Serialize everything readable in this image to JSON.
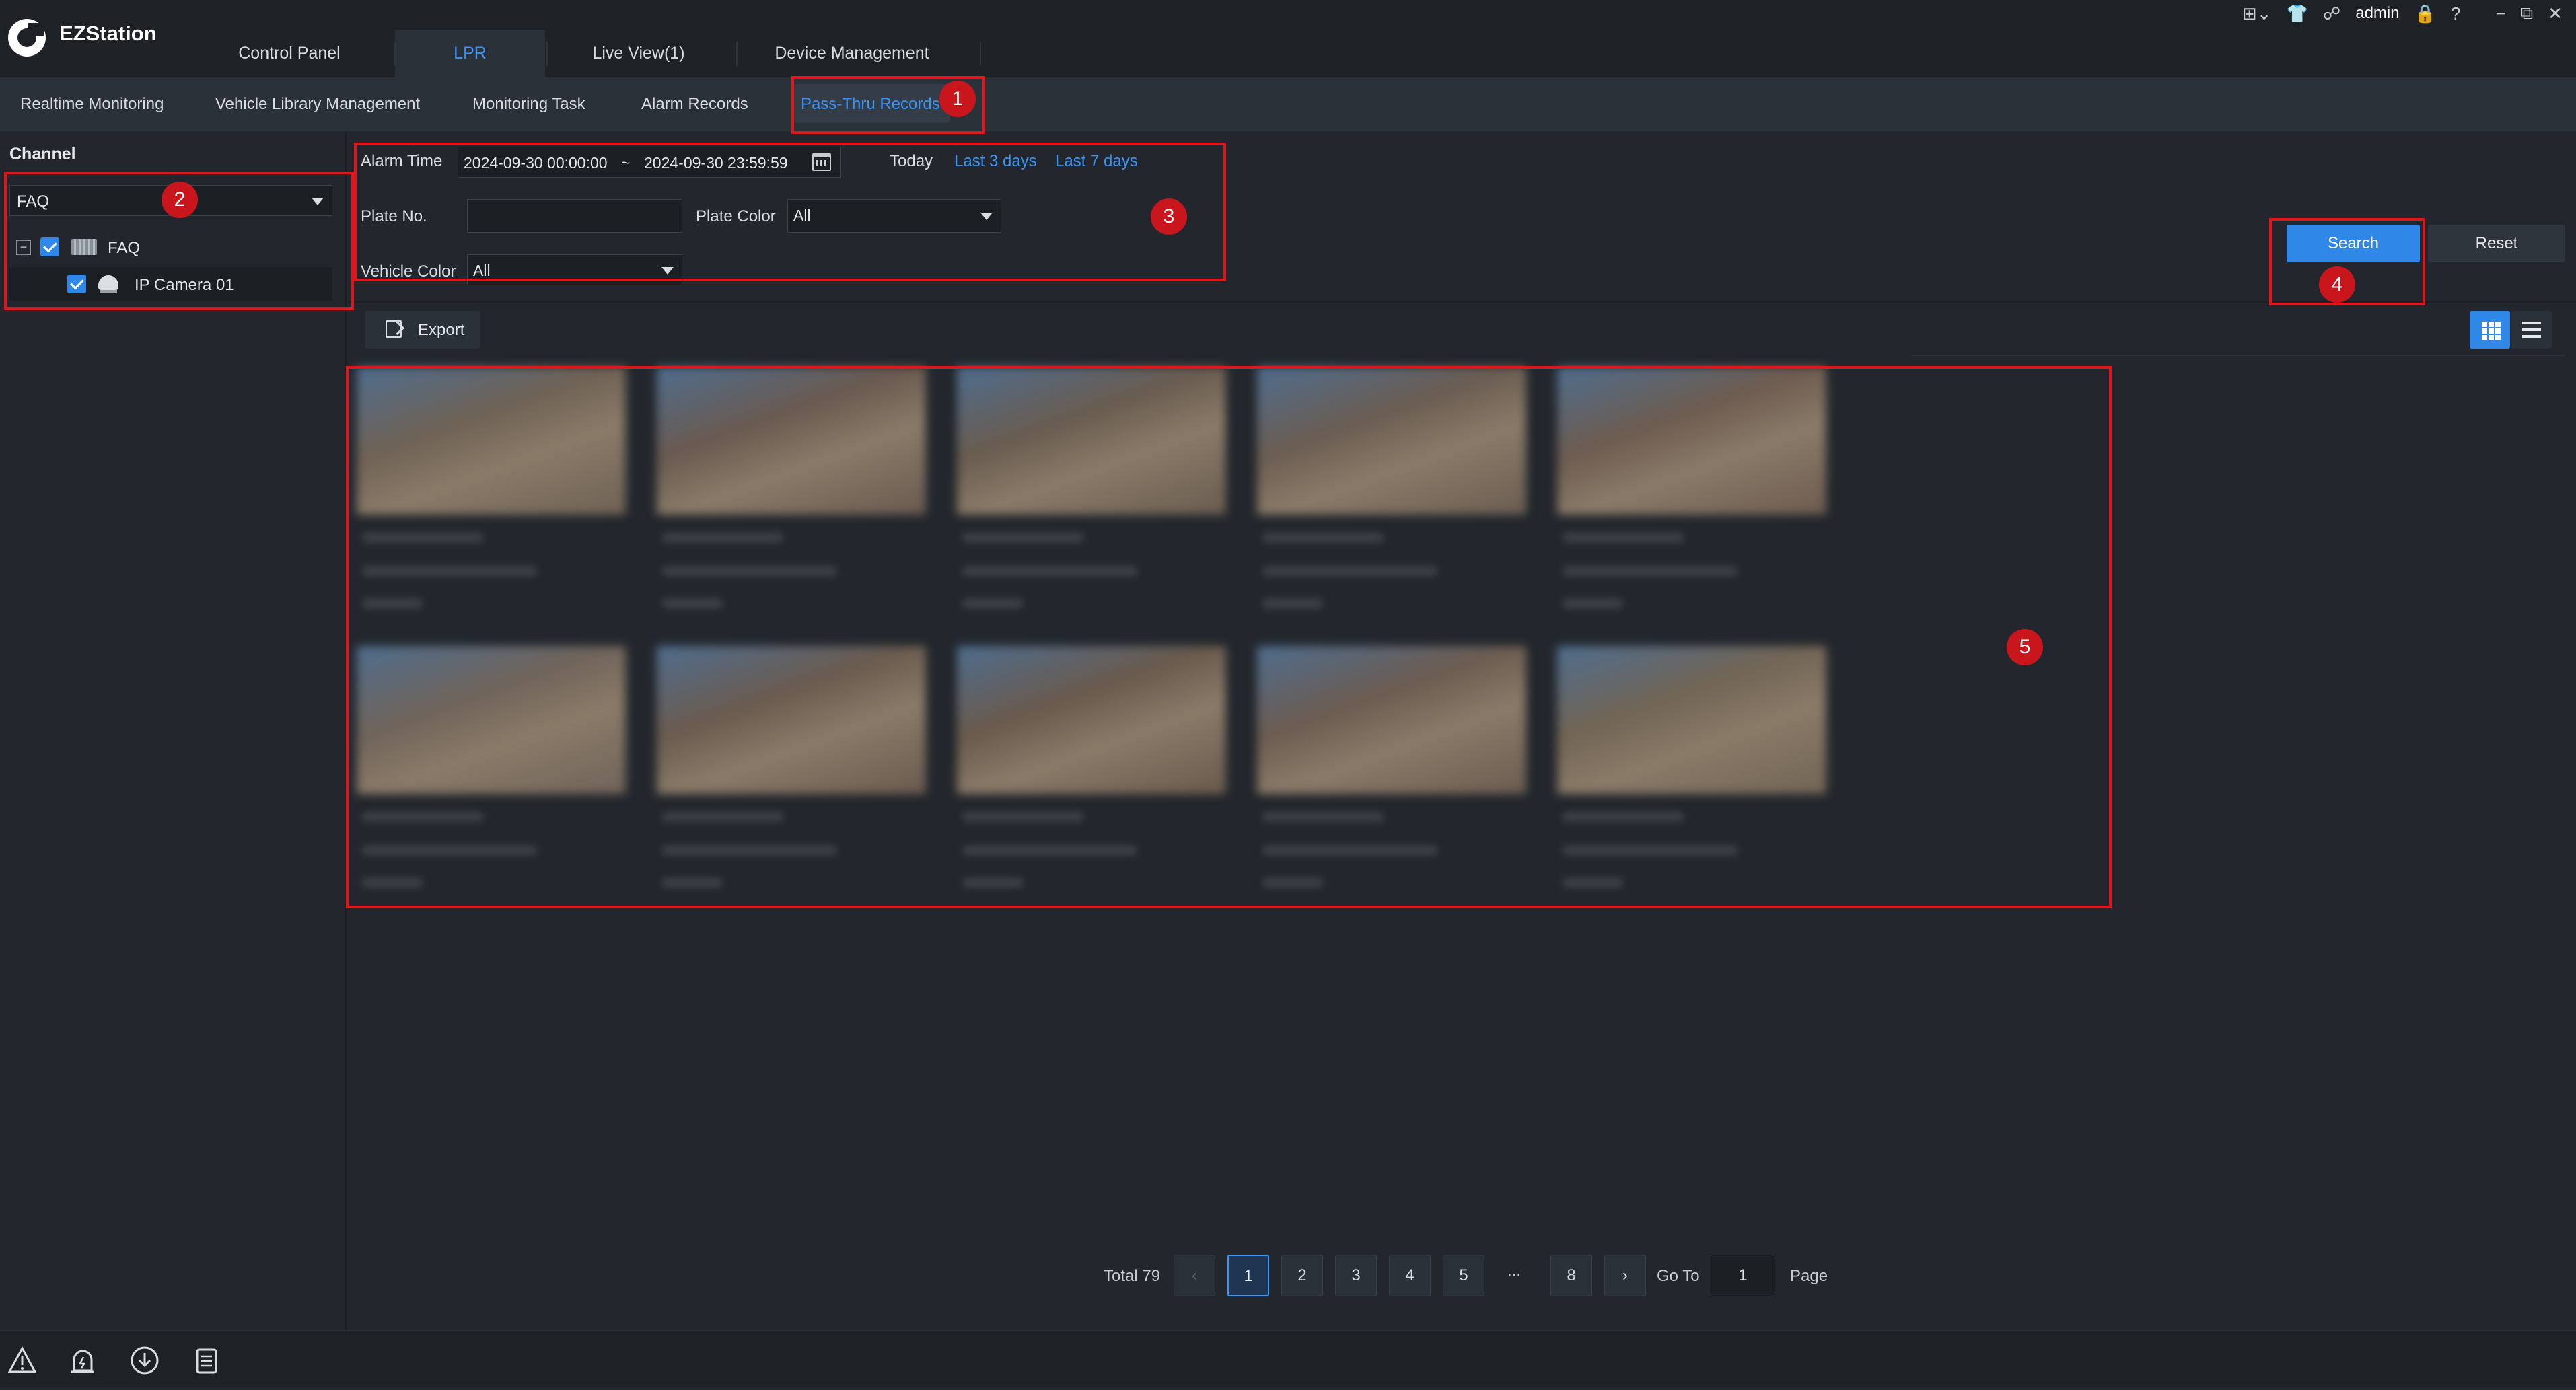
{
  "app": {
    "name": "EZStation"
  },
  "main_tabs": [
    {
      "label": "Control Panel",
      "active": false
    },
    {
      "label": "LPR",
      "active": true
    },
    {
      "label": "Live View(1)",
      "active": false
    },
    {
      "label": "Device Management",
      "active": false
    }
  ],
  "system": {
    "user": "admin",
    "icons": [
      "layout-grid-icon",
      "skin-shirt-icon",
      "user-group-icon",
      "lock-icon",
      "help-icon",
      "minimize-icon",
      "restore-icon",
      "close-icon"
    ]
  },
  "sub_tabs": [
    {
      "label": "Realtime Monitoring",
      "active": false
    },
    {
      "label": "Vehicle Library Management",
      "active": false
    },
    {
      "label": "Monitoring Task",
      "active": false
    },
    {
      "label": "Alarm Records",
      "active": false
    },
    {
      "label": "Pass-Thru Records",
      "active": true
    }
  ],
  "sidebar": {
    "title": "Channel",
    "select_value": "FAQ",
    "tree": {
      "root": {
        "label": "FAQ",
        "checked": true,
        "expanded": true
      },
      "child": {
        "label": "IP Camera 01",
        "checked": true
      }
    }
  },
  "filters": {
    "alarm_time_label": "Alarm Time",
    "start": "2024-09-30 00:00:00",
    "separator": "~",
    "end": "2024-09-30 23:59:59",
    "quick": {
      "today": "Today",
      "last3": "Last 3 days",
      "last7": "Last 7 days"
    },
    "plate_no_label": "Plate No.",
    "plate_no_value": "",
    "plate_color_label": "Plate Color",
    "plate_color_value": "All",
    "vehicle_color_label": "Vehicle Color",
    "vehicle_color_value": "All",
    "search_label": "Search",
    "reset_label": "Reset"
  },
  "toolbar": {
    "export_label": "Export",
    "view_mode": "grid"
  },
  "results": {
    "card_count": 10,
    "thumb_colors": [
      "#6f6255",
      "#6a5a50",
      "#695c50",
      "#6b5d52",
      "#6d5c50",
      "#70645a",
      "#6b5b4f",
      "#6a5a4d",
      "#6c5c51",
      "#726555"
    ]
  },
  "pagination": {
    "total_label": "Total 79",
    "pages": [
      "1",
      "2",
      "3",
      "4",
      "5",
      "...",
      "8"
    ],
    "current": "1",
    "goto_label": "Go To",
    "goto_value": "1",
    "page_label": "Page"
  },
  "status_icons": [
    "alarm-warning-icon",
    "device-alert-icon",
    "download-icon",
    "task-list-icon"
  ],
  "annotations": [
    "1",
    "2",
    "3",
    "4",
    "5"
  ],
  "colors": {
    "accent": "#2f87e8",
    "annotation": "#e0161d",
    "background": "#23272d"
  }
}
